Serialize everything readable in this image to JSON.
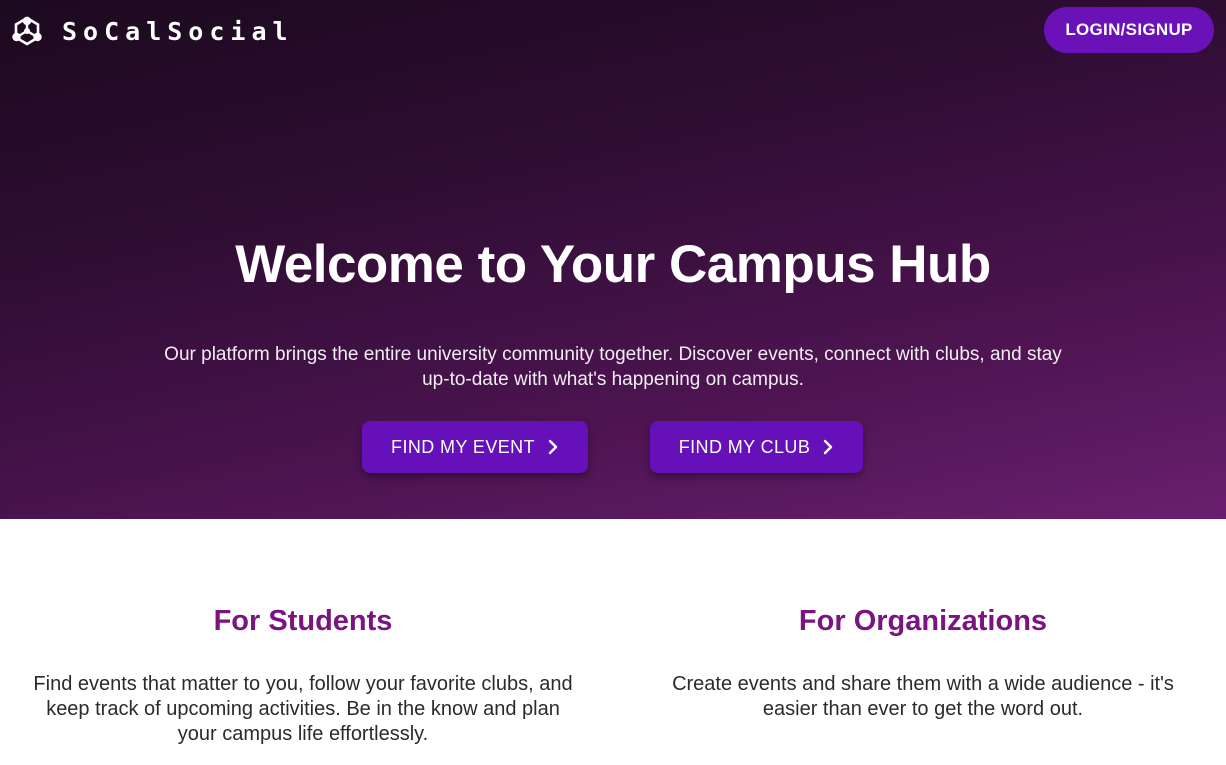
{
  "brand": {
    "name": "SoCalSocial",
    "icon": "hexagon-network-logo-icon"
  },
  "header": {
    "login_label": "LOGIN/SIGNUP"
  },
  "hero": {
    "title": "Welcome to Your Campus Hub",
    "subtitle": "Our platform brings the entire university community together. Discover events, connect with clubs, and stay up-to-date with what's happening on campus.",
    "buttons": [
      {
        "label": "FIND MY EVENT",
        "icon": "chevron-right-icon"
      },
      {
        "label": "FIND MY CLUB",
        "icon": "chevron-right-icon"
      }
    ]
  },
  "features": [
    {
      "title": "For Students",
      "body": "Find events that matter to you, follow your favorite clubs, and keep track of upcoming activities. Be in the know and plan your campus life effortlessly."
    },
    {
      "title": "For Organizations",
      "body": "Create events and share them with a wide audience - it's easier than ever to get the word out."
    }
  ],
  "colors": {
    "accent": "#6510b8",
    "heading": "#7a1480",
    "hero_dark": "#1c0a1f",
    "hero_light": "#6a1f6f"
  }
}
